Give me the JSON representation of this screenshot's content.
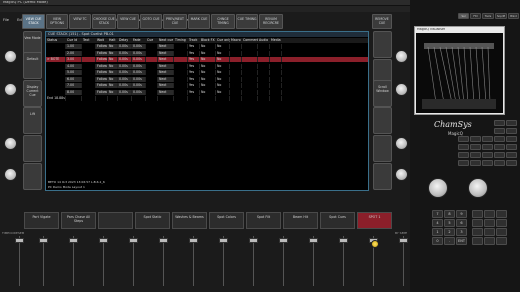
{
  "window": {
    "title": "MagicQ PC (Demo Mode)"
  },
  "menu": [
    "File",
    "Edit",
    "Setup",
    "Layout",
    "Window",
    "Help",
    "Tools",
    "Visualiser",
    "Media Pause",
    "View",
    "Help"
  ],
  "top_tabs": [
    {
      "label": "VIEW CUE STACK",
      "active": true
    },
    {
      "label": "VIEW OPTIONS",
      "active": false
    },
    {
      "label": "VIEW TC",
      "active": false
    },
    {
      "label": "CHOOSE CUE STACK",
      "active": false
    },
    {
      "label": "VIEW CUE",
      "active": false
    },
    {
      "label": "GOTO CUE",
      "active": false
    },
    {
      "label": "PREV/NEXT CUE",
      "active": false
    },
    {
      "label": "MARK CUE",
      "active": false
    },
    {
      "label": "CHNGE TIMING",
      "active": false
    },
    {
      "label": "CUE TIMING",
      "active": false
    },
    {
      "label": "RENUM RECIRCRE",
      "active": false
    }
  ],
  "top_right_tab": "REMOVE CUE",
  "left_buttons": [
    {
      "label": "Vew Mode"
    },
    {
      "label": "Default"
    },
    {
      "label": "Display Current Cue"
    },
    {
      "label": "Lift"
    },
    {
      "label": ""
    },
    {
      "label": ""
    }
  ],
  "right_buttons": [
    {
      "label": ""
    },
    {
      "label": ""
    },
    {
      "label": "Scroll Window"
    },
    {
      "label": ""
    },
    {
      "label": ""
    },
    {
      "label": ""
    }
  ],
  "cuestack": {
    "header": "CUE STACK (151) - Spot Cuelist PB-01",
    "columns": [
      "Status",
      "Cue Id",
      "Text",
      "Wait",
      "Halt",
      "Delay",
      "Fade",
      "Cue",
      "Next cue",
      "Timing",
      "Track",
      "Block FX",
      "Cue only",
      "Macro",
      "Comment",
      "Audio",
      "Media"
    ],
    "rows": [
      [
        "",
        "1.00",
        "",
        "Follow",
        "No",
        "0.00s",
        "0.00s",
        "",
        "Next",
        "",
        "Yes",
        "No",
        "No",
        "",
        "",
        "",
        ""
      ],
      [
        "",
        "2.00",
        "",
        "Follow",
        "No",
        "0.00s",
        "0.00s",
        "",
        "Next",
        "",
        "Yes",
        "No",
        "No",
        "",
        "",
        "",
        ""
      ],
      [
        "> BOTE",
        "3.00",
        "",
        "Follow",
        "No",
        "0.00s",
        "0.00s",
        "",
        "Next",
        "",
        "Yes",
        "No",
        "No",
        "",
        "",
        "",
        ""
      ],
      [
        "",
        "4.00",
        "",
        "Follow",
        "No",
        "0.00s",
        "0.00s",
        "",
        "Next",
        "",
        "Yes",
        "No",
        "No",
        "",
        "",
        "",
        ""
      ],
      [
        "",
        "5.00",
        "",
        "Follow",
        "No",
        "0.00s",
        "0.00s",
        "",
        "Next",
        "",
        "Yes",
        "No",
        "No",
        "",
        "",
        "",
        ""
      ],
      [
        "",
        "6.00",
        "",
        "Follow",
        "No",
        "0.00s",
        "0.00s",
        "",
        "Next",
        "",
        "Yes",
        "No",
        "No",
        "",
        "",
        "",
        ""
      ],
      [
        "",
        "7.00",
        "",
        "Follow",
        "No",
        "0.00s",
        "0.00s",
        "",
        "Next",
        "",
        "Yes",
        "No",
        "No",
        "",
        "",
        "",
        ""
      ],
      [
        "",
        "8.00",
        "",
        "Follow",
        "No",
        "0.00s",
        "0.00s",
        "",
        "Next",
        "",
        "Yes",
        "No",
        "No",
        "",
        "",
        "",
        ""
      ],
      [
        "End 18.88s",
        "",
        "",
        "",
        "",
        "",
        "",
        "",
        "",
        "",
        "",
        "",
        "",
        "",
        "",
        "",
        ""
      ]
    ],
    "footer_lines": [
      "BETO 14 Oct 2023 13:06:57 L.B.6.1_6",
      "PC Demo Mode  Layout 1"
    ]
  },
  "playbacks": [
    {
      "label": "Port Vigate"
    },
    {
      "label": "Pars Chase All Steps"
    },
    {
      "label": ""
    },
    {
      "label": "Spot Static"
    },
    {
      "label": "Washes & Beams"
    },
    {
      "label": "Spot Colors"
    },
    {
      "label": "Spot Filt"
    },
    {
      "label": "Beam Hit"
    },
    {
      "label": "Spot Cues"
    },
    {
      "label": "SPOT 1"
    }
  ],
  "bottom_status": {
    "left": "TIMECODE",
    "mid": "SEM",
    "right": "BY SEPE"
  },
  "visualiser": {
    "title": "MagicQ Visualiser"
  },
  "brand": {
    "name": "ChamSys",
    "product": "MagicQ"
  },
  "right_top_buttons": [
    "Sel",
    "Ftrl",
    "Tools",
    "Snp/M",
    "Blind"
  ],
  "keypad_keys": [
    "7",
    "8",
    "9",
    "4",
    "5",
    "6",
    "1",
    "2",
    "3",
    "0",
    ".",
    "ENT"
  ]
}
